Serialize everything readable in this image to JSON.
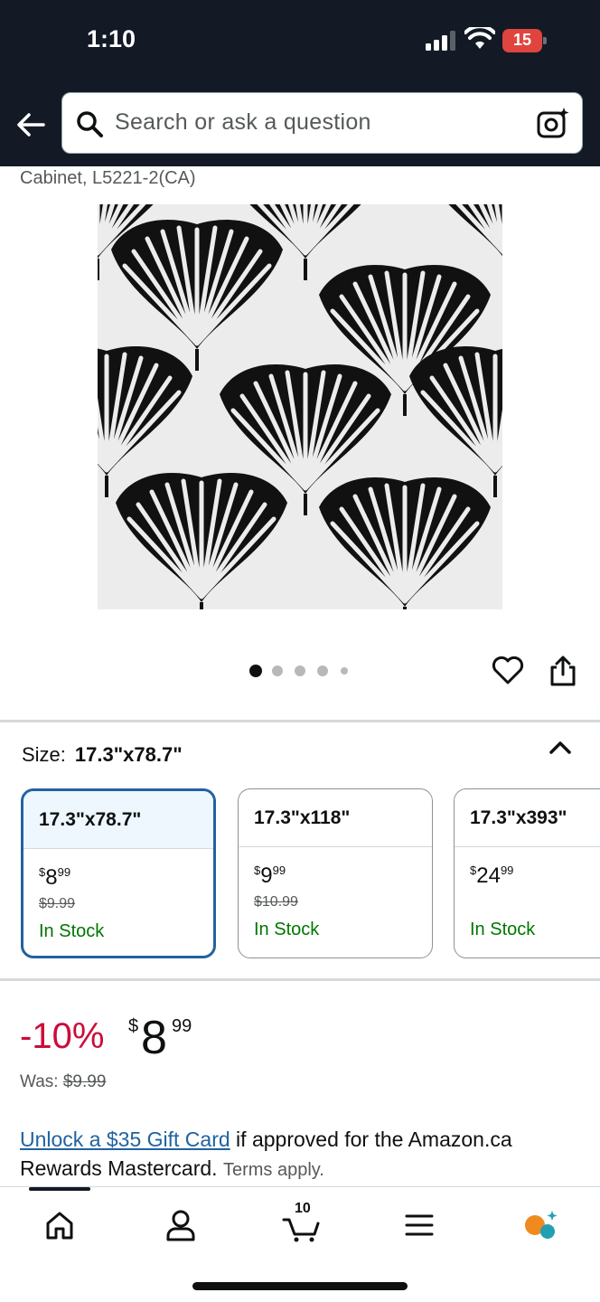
{
  "status_bar": {
    "time": "1:10",
    "battery": "15"
  },
  "search": {
    "placeholder": "Search or ask a question"
  },
  "breadcrumb": "Cabinet, L5221-2(CA)",
  "gallery": {
    "image_count": 5,
    "active_index": 0
  },
  "size": {
    "label": "Size:",
    "selected": "17.3\"x78.7\"",
    "options": [
      {
        "name": "17.3\"x78.7\"",
        "price_dollars": "8",
        "price_cents": "99",
        "was": "$9.99",
        "stock": "In Stock"
      },
      {
        "name": "17.3\"x118\"",
        "price_dollars": "9",
        "price_cents": "99",
        "was": "$10.99",
        "stock": "In Stock"
      },
      {
        "name": "17.3\"x393\"",
        "price_dollars": "24",
        "price_cents": "99",
        "was": "",
        "stock": "In Stock"
      }
    ]
  },
  "deal": {
    "discount": "-10%",
    "currency": "$",
    "price_dollars": "8",
    "price_cents": "99",
    "was_label": "Was:",
    "was_price": "$9.99"
  },
  "promo": {
    "link": "Unlock a $35 Gift Card",
    "text": " if approved for the Amazon.ca Rewards Mastercard.",
    "terms": "Terms apply."
  },
  "bottom_nav": {
    "cart_count": "10"
  },
  "colors": {
    "header": "#131a26",
    "link": "#2162a1",
    "deal": "#cc0c39",
    "stock": "#007600",
    "selected_border": "#2162a1"
  }
}
